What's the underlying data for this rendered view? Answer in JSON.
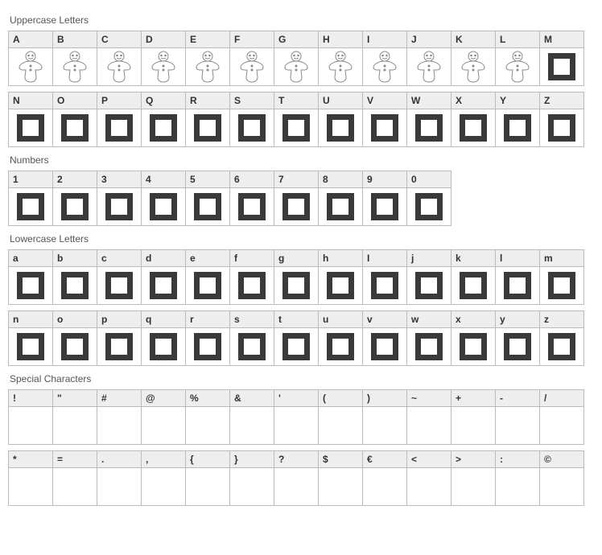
{
  "sections": [
    {
      "title": "Uppercase Letters",
      "rows": [
        [
          {
            "label": "A",
            "glyph": "gingerbread"
          },
          {
            "label": "B",
            "glyph": "gingerbread"
          },
          {
            "label": "C",
            "glyph": "gingerbread"
          },
          {
            "label": "D",
            "glyph": "gingerbread"
          },
          {
            "label": "E",
            "glyph": "gingerbread"
          },
          {
            "label": "F",
            "glyph": "gingerbread"
          },
          {
            "label": "G",
            "glyph": "gingerbread"
          },
          {
            "label": "H",
            "glyph": "gingerbread"
          },
          {
            "label": "I",
            "glyph": "gingerbread"
          },
          {
            "label": "J",
            "glyph": "gingerbread"
          },
          {
            "label": "K",
            "glyph": "gingerbread"
          },
          {
            "label": "L",
            "glyph": "gingerbread"
          },
          {
            "label": "M",
            "glyph": "missing"
          }
        ],
        [
          {
            "label": "N",
            "glyph": "missing"
          },
          {
            "label": "O",
            "glyph": "missing"
          },
          {
            "label": "P",
            "glyph": "missing"
          },
          {
            "label": "Q",
            "glyph": "missing"
          },
          {
            "label": "R",
            "glyph": "missing"
          },
          {
            "label": "S",
            "glyph": "missing"
          },
          {
            "label": "T",
            "glyph": "missing"
          },
          {
            "label": "U",
            "glyph": "missing"
          },
          {
            "label": "V",
            "glyph": "missing"
          },
          {
            "label": "W",
            "glyph": "missing"
          },
          {
            "label": "X",
            "glyph": "missing"
          },
          {
            "label": "Y",
            "glyph": "missing"
          },
          {
            "label": "Z",
            "glyph": "missing"
          }
        ]
      ]
    },
    {
      "title": "Numbers",
      "rows": [
        [
          {
            "label": "1",
            "glyph": "missing"
          },
          {
            "label": "2",
            "glyph": "missing"
          },
          {
            "label": "3",
            "glyph": "missing"
          },
          {
            "label": "4",
            "glyph": "missing"
          },
          {
            "label": "5",
            "glyph": "missing"
          },
          {
            "label": "6",
            "glyph": "missing"
          },
          {
            "label": "7",
            "glyph": "missing"
          },
          {
            "label": "8",
            "glyph": "missing"
          },
          {
            "label": "9",
            "glyph": "missing"
          },
          {
            "label": "0",
            "glyph": "missing"
          }
        ]
      ]
    },
    {
      "title": "Lowercase Letters",
      "rows": [
        [
          {
            "label": "a",
            "glyph": "missing"
          },
          {
            "label": "b",
            "glyph": "missing"
          },
          {
            "label": "c",
            "glyph": "missing"
          },
          {
            "label": "d",
            "glyph": "missing"
          },
          {
            "label": "e",
            "glyph": "missing"
          },
          {
            "label": "f",
            "glyph": "missing"
          },
          {
            "label": "g",
            "glyph": "missing"
          },
          {
            "label": "h",
            "glyph": "missing"
          },
          {
            "label": "I",
            "glyph": "missing"
          },
          {
            "label": "j",
            "glyph": "missing"
          },
          {
            "label": "k",
            "glyph": "missing"
          },
          {
            "label": "l",
            "glyph": "missing"
          },
          {
            "label": "m",
            "glyph": "missing"
          }
        ],
        [
          {
            "label": "n",
            "glyph": "missing"
          },
          {
            "label": "o",
            "glyph": "missing"
          },
          {
            "label": "p",
            "glyph": "missing"
          },
          {
            "label": "q",
            "glyph": "missing"
          },
          {
            "label": "r",
            "glyph": "missing"
          },
          {
            "label": "s",
            "glyph": "missing"
          },
          {
            "label": "t",
            "glyph": "missing"
          },
          {
            "label": "u",
            "glyph": "missing"
          },
          {
            "label": "v",
            "glyph": "missing"
          },
          {
            "label": "w",
            "glyph": "missing"
          },
          {
            "label": "x",
            "glyph": "missing"
          },
          {
            "label": "y",
            "glyph": "missing"
          },
          {
            "label": "z",
            "glyph": "missing"
          }
        ]
      ]
    },
    {
      "title": "Special Characters",
      "rows": [
        [
          {
            "label": "!",
            "glyph": "blank"
          },
          {
            "label": "\"",
            "glyph": "blank"
          },
          {
            "label": "#",
            "glyph": "blank"
          },
          {
            "label": "@",
            "glyph": "blank"
          },
          {
            "label": "%",
            "glyph": "blank"
          },
          {
            "label": "&",
            "glyph": "blank"
          },
          {
            "label": "'",
            "glyph": "blank"
          },
          {
            "label": "(",
            "glyph": "blank"
          },
          {
            "label": ")",
            "glyph": "blank"
          },
          {
            "label": "~",
            "glyph": "blank"
          },
          {
            "label": "+",
            "glyph": "blank"
          },
          {
            "label": "-",
            "glyph": "blank"
          },
          {
            "label": "/",
            "glyph": "blank"
          }
        ],
        [
          {
            "label": "*",
            "glyph": "blank"
          },
          {
            "label": "=",
            "glyph": "blank"
          },
          {
            "label": ".",
            "glyph": "blank"
          },
          {
            "label": ",",
            "glyph": "blank"
          },
          {
            "label": "{",
            "glyph": "blank"
          },
          {
            "label": "}",
            "glyph": "blank"
          },
          {
            "label": "?",
            "glyph": "blank"
          },
          {
            "label": "$",
            "glyph": "blank"
          },
          {
            "label": "€",
            "glyph": "blank"
          },
          {
            "label": "<",
            "glyph": "blank"
          },
          {
            "label": ">",
            "glyph": "blank"
          },
          {
            "label": ":",
            "glyph": "blank"
          },
          {
            "label": "©",
            "glyph": "blank"
          }
        ]
      ]
    }
  ]
}
